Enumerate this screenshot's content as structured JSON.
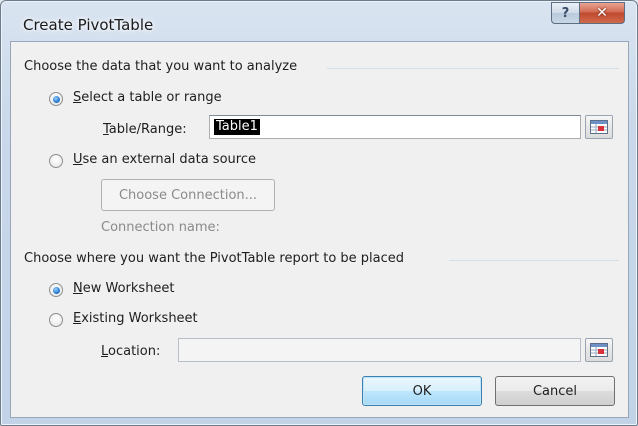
{
  "window": {
    "title": "Create PivotTable",
    "help_glyph": "?",
    "close_glyph": "✕"
  },
  "analyze_group": {
    "title": "Choose the data that you want to analyze",
    "select_range_option": {
      "accel": "S",
      "rest": "elect a table or range",
      "checked": true
    },
    "table_range": {
      "label_accel": "T",
      "label_rest": "able/Range:",
      "value": "Table1"
    },
    "external_option": {
      "accel": "U",
      "rest": "se an external data source",
      "checked": false
    },
    "choose_connection_label": "Choose Connection...",
    "connection_name_label": "Connection name:"
  },
  "placement_group": {
    "title": "Choose where you want the PivotTable report to be placed",
    "new_worksheet_option": {
      "accel": "N",
      "rest": "ew Worksheet",
      "checked": true
    },
    "existing_worksheet_option": {
      "accel": "E",
      "rest": "xisting Worksheet",
      "checked": false
    },
    "location": {
      "label_accel": "L",
      "label_rest": "ocation:",
      "value": ""
    }
  },
  "buttons": {
    "ok_label": "OK",
    "cancel_label": "Cancel"
  },
  "icons": {
    "help": "help-icon",
    "close": "close-icon",
    "range_picker": "range-picker-icon"
  }
}
